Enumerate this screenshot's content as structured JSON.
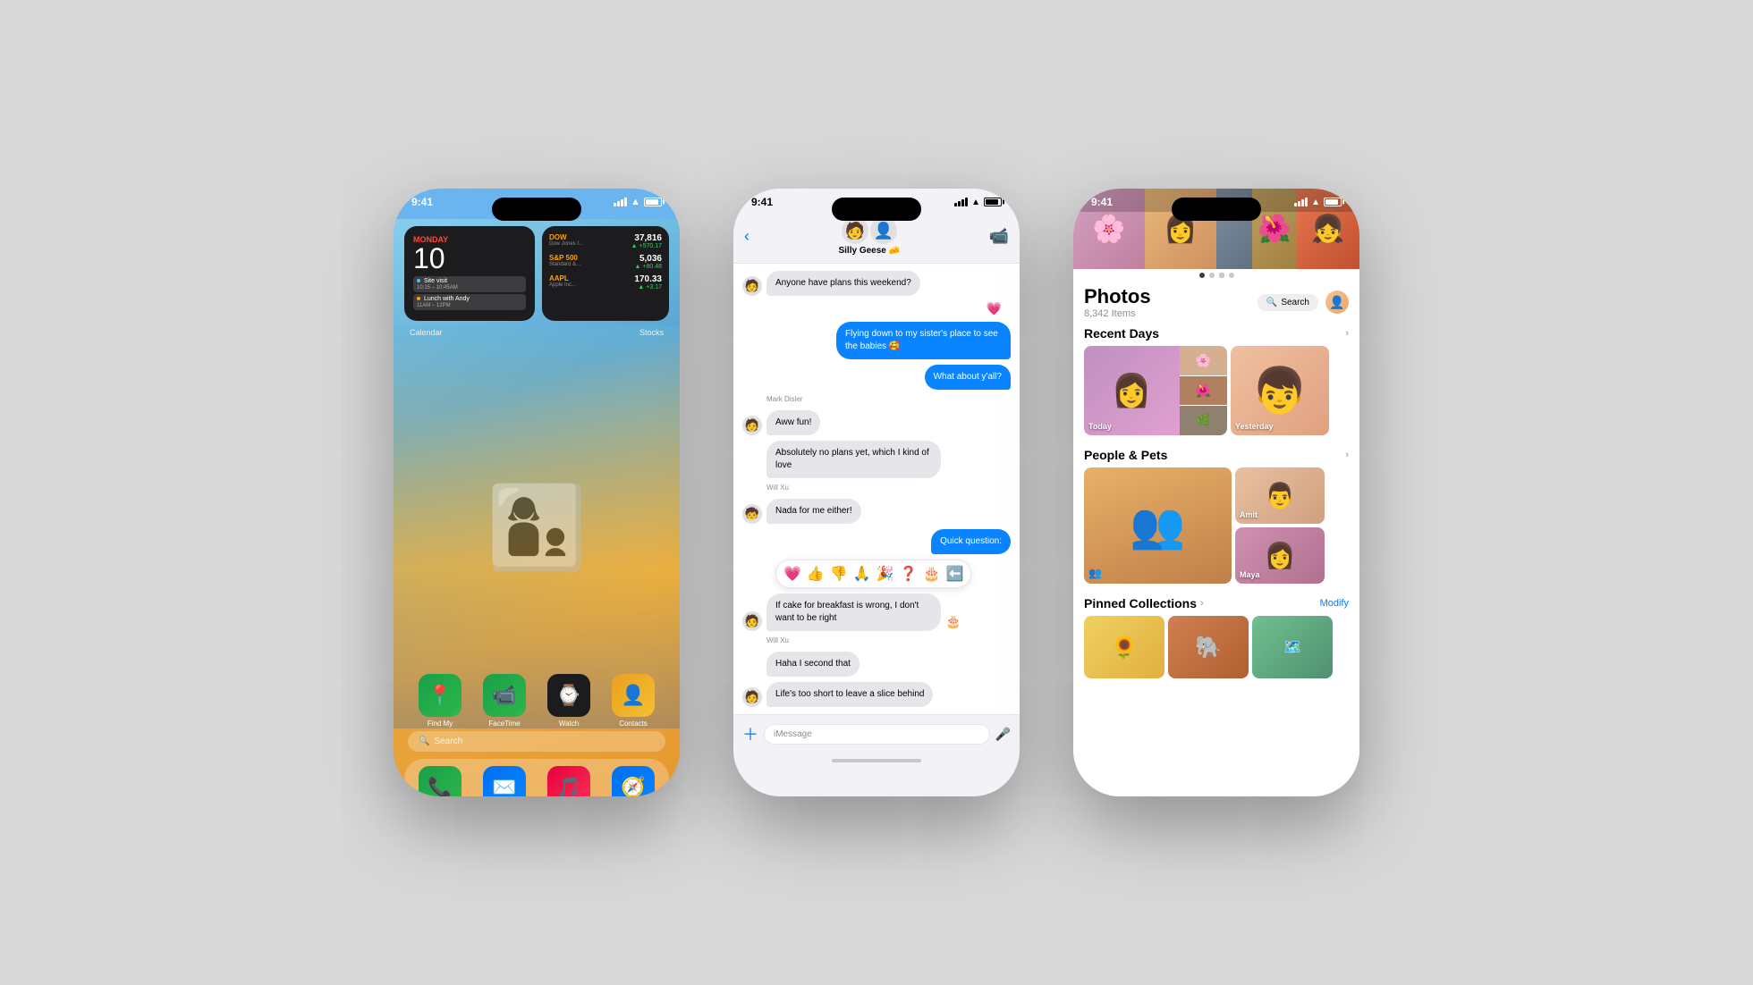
{
  "bg_color": "#d8d8d8",
  "phones": [
    {
      "id": "home",
      "status_time": "9:41",
      "widgets": {
        "calendar": {
          "day": "MONDAY",
          "date": "10",
          "events": [
            {
              "dot_color": "#4fc3f7",
              "title": "Site visit",
              "time": "10:15 – 10:45AM"
            },
            {
              "dot_color": "#ff9f0a",
              "title": "Lunch with Andy",
              "time": "11AM – 12PM"
            }
          ]
        },
        "stocks": [
          {
            "name": "DOW",
            "sub": "Dow Jones I...",
            "price": "37,816",
            "change": "▲ +570.17"
          },
          {
            "name": "S&P 500",
            "sub": "Standard &...",
            "price": "5,036",
            "change": "▲ +80.48"
          },
          {
            "name": "AAPL",
            "sub": "Apple Inc...",
            "price": "170.33",
            "change": "▲ +3.17"
          }
        ]
      },
      "widget_labels": [
        "Calendar",
        "Stocks"
      ],
      "apps": [
        {
          "name": "Find My",
          "icon": "📍",
          "bg": "#f5a623"
        },
        {
          "name": "FaceTime",
          "icon": "📹",
          "bg": "#2db84b"
        },
        {
          "name": "Watch",
          "icon": "⌚",
          "bg": "#1c1c1e"
        },
        {
          "name": "Contacts",
          "icon": "👤",
          "bg": "#f5a623"
        }
      ],
      "search_label": "Search",
      "dock_apps": [
        {
          "name": "Phone",
          "icon": "📞",
          "bg": "#2db84b"
        },
        {
          "name": "Mail",
          "icon": "✉️",
          "bg": "#0a84ff"
        },
        {
          "name": "Music",
          "icon": "🎵",
          "bg": "#fc3158"
        },
        {
          "name": "Safari",
          "icon": "🧭",
          "bg": "#0a84ff"
        }
      ]
    },
    {
      "id": "messages",
      "status_time": "9:41",
      "contact_name": "Silly Geese 🧀",
      "contact_emoji1": "🧑",
      "contact_emoji2": "👤",
      "messages": [
        {
          "type": "received",
          "text": "Anyone have plans this weekend?",
          "sender": null,
          "avatar": "🧑"
        },
        {
          "type": "heart",
          "text": "💗"
        },
        {
          "type": "sent",
          "text": "Flying down to my sister's place to see the babies 🥰"
        },
        {
          "type": "sent",
          "text": "What about y'all?"
        },
        {
          "type": "sender_label",
          "text": "Mark Disler"
        },
        {
          "type": "received",
          "text": "Aww fun!",
          "avatar": "🧑"
        },
        {
          "type": "received_plain",
          "text": "Absolutely no plans yet, which I kind of love"
        },
        {
          "type": "sender_label",
          "text": "Will Xu"
        },
        {
          "type": "received",
          "text": "Nada for me either!",
          "avatar": "🧒"
        },
        {
          "type": "sent",
          "text": "Quick question:"
        },
        {
          "type": "tapback",
          "emojis": [
            "💗",
            "👍",
            "👎",
            "🙏",
            "🎉",
            "❓",
            "🎂",
            "⬅️"
          ]
        },
        {
          "type": "received",
          "text": "If cake for breakfast is wrong, I don't want to be right",
          "avatar": "🧑"
        },
        {
          "type": "sender_label",
          "text": "Will Xu"
        },
        {
          "type": "received_plain",
          "text": "Haha I second that"
        },
        {
          "type": "received_plain",
          "text": "Life's too short to leave a slice behind"
        }
      ],
      "input_placeholder": "iMessage"
    },
    {
      "id": "photos",
      "status_time": "9:41",
      "title": "Photos",
      "items_count": "8,342 Items",
      "search_label": "Search",
      "sections": {
        "recent_days": {
          "label": "Recent Days",
          "items": [
            {
              "label": "Today"
            },
            {
              "label": "Yesterday"
            }
          ]
        },
        "people_pets": {
          "label": "People & Pets",
          "items": [
            {
              "label": "Amit"
            },
            {
              "label": "Maya"
            }
          ]
        },
        "pinned": {
          "label": "Pinned Collections",
          "modify": "Modify"
        }
      }
    }
  ]
}
